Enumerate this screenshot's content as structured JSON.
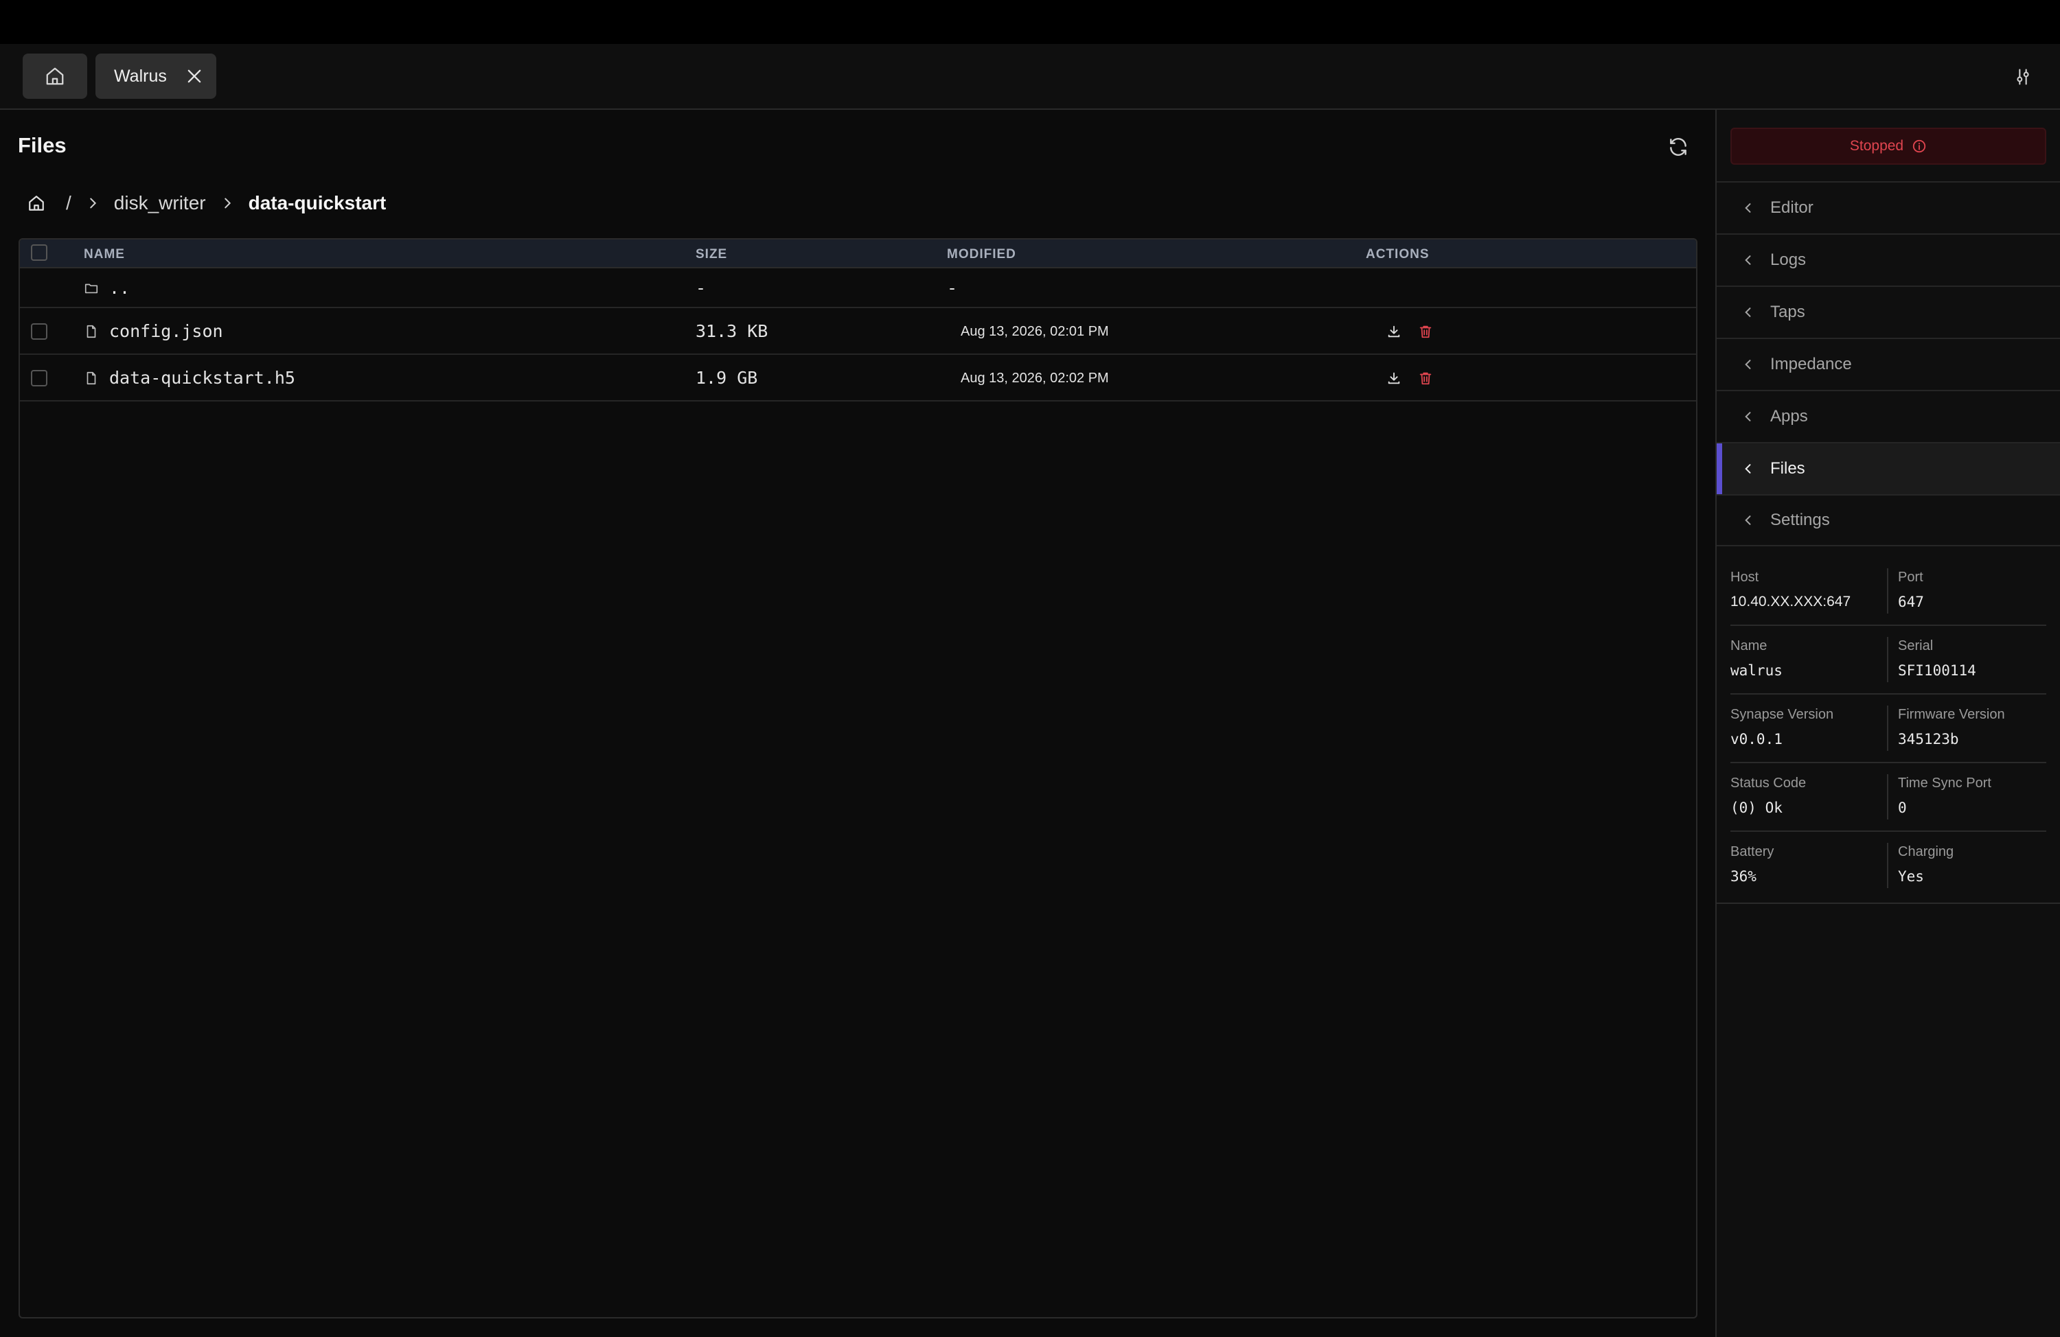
{
  "tabs": {
    "device_label": "Walrus"
  },
  "page": {
    "title": "Files"
  },
  "breadcrumb": {
    "separator": "/",
    "items": [
      "disk_writer",
      "data-quickstart"
    ]
  },
  "table": {
    "headers": {
      "name": "NAME",
      "size": "SIZE",
      "modified": "MODIFIED",
      "actions": "ACTIONS"
    },
    "parent_row": {
      "name": "..",
      "size": "-",
      "modified": "-"
    },
    "rows": [
      {
        "name": "config.json",
        "size": "31.3 KB",
        "modified": "Aug 13, 2026, 02:01 PM"
      },
      {
        "name": "data-quickstart.h5",
        "size": "1.9 GB",
        "modified": "Aug 13, 2026, 02:02 PM"
      }
    ]
  },
  "sidebar": {
    "status": "Stopped",
    "nav": [
      "Editor",
      "Logs",
      "Taps",
      "Impedance",
      "Apps",
      "Files",
      "Settings"
    ],
    "active_nav": "Files",
    "info": [
      {
        "k1": "Host",
        "v1": "10.40.XX.XXX:647",
        "k2": "Port",
        "v2": "647"
      },
      {
        "k1": "Name",
        "v1": "walrus",
        "k2": "Serial",
        "v2": "SFI100114"
      },
      {
        "k1": "Synapse Version",
        "v1": "v0.0.1",
        "k2": "Firmware Version",
        "v2": "345123b"
      },
      {
        "k1": "Status Code",
        "v1": "(0) Ok",
        "k2": "Time Sync Port",
        "v2": "0"
      },
      {
        "k1": "Battery",
        "v1": "36%",
        "k2": "Charging",
        "v2": "Yes"
      }
    ]
  },
  "colors": {
    "accent": "#5b4fd0",
    "danger": "#e0454f",
    "header_bg": "#1a1f29"
  }
}
